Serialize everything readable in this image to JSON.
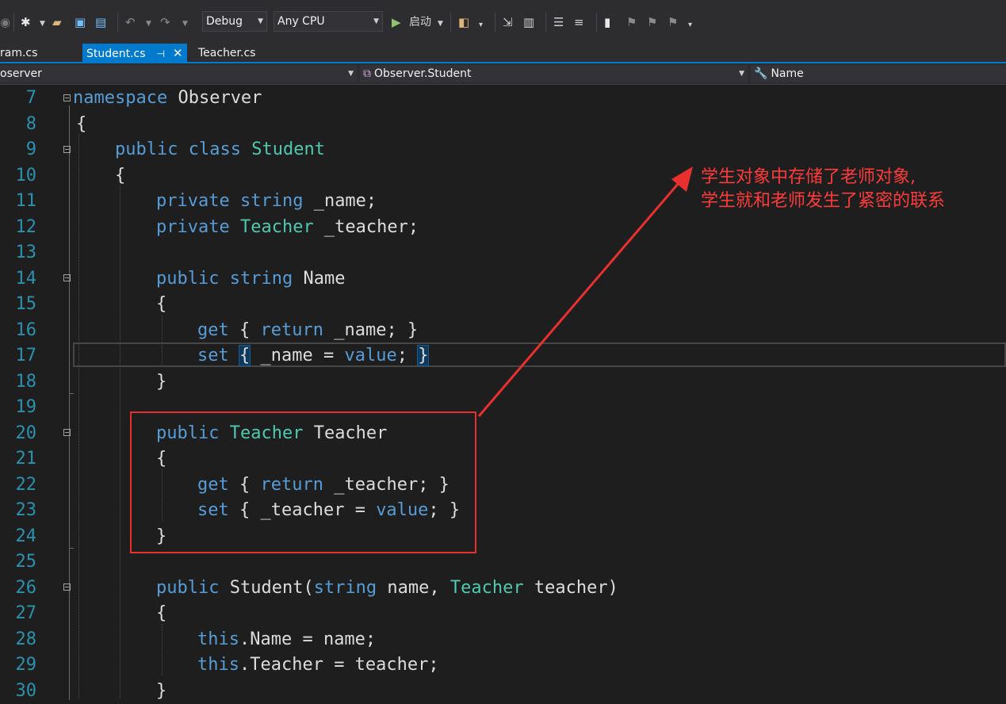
{
  "toolbar": {
    "config": "Debug",
    "platform": "Any CPU",
    "start_label": "启动"
  },
  "tabs": [
    {
      "label": "ram.cs"
    },
    {
      "label": "Student.cs"
    },
    {
      "label": "Teacher.cs"
    }
  ],
  "navbar": {
    "project": "oserver",
    "type": "Observer.Student",
    "member": "Name"
  },
  "lines": [
    {
      "n": "7"
    },
    {
      "n": "8"
    },
    {
      "n": "9"
    },
    {
      "n": "10"
    },
    {
      "n": "11"
    },
    {
      "n": "12"
    },
    {
      "n": "13"
    },
    {
      "n": "14"
    },
    {
      "n": "15"
    },
    {
      "n": "16"
    },
    {
      "n": "17"
    },
    {
      "n": "18"
    },
    {
      "n": "19"
    },
    {
      "n": "20"
    },
    {
      "n": "21"
    },
    {
      "n": "22"
    },
    {
      "n": "23"
    },
    {
      "n": "24"
    },
    {
      "n": "25"
    },
    {
      "n": "26"
    },
    {
      "n": "27"
    },
    {
      "n": "28"
    },
    {
      "n": "29"
    },
    {
      "n": "30"
    }
  ],
  "code": {
    "l7": [
      "namespace",
      " Observer"
    ],
    "l8": [
      "{"
    ],
    "l9": [
      "public",
      " ",
      "class",
      " ",
      "Student"
    ],
    "l10": [
      "{"
    ],
    "l11": [
      "private",
      " ",
      "string",
      " _name;"
    ],
    "l12": [
      "private",
      " ",
      "Teacher",
      " _teacher;"
    ],
    "l14": [
      "public",
      " ",
      "string",
      " Name"
    ],
    "l15": [
      "{"
    ],
    "l16": [
      "get",
      " { ",
      "return",
      " _name; }"
    ],
    "l17": [
      "set",
      " ",
      "{",
      " _name = ",
      "value",
      "; ",
      "}"
    ],
    "l18": [
      "}"
    ],
    "l20": [
      "public",
      " ",
      "Teacher",
      " Teacher"
    ],
    "l21": [
      "{"
    ],
    "l22": [
      "get",
      " { ",
      "return",
      " _teacher; }"
    ],
    "l23": [
      "set",
      " { _teacher = ",
      "value",
      "; }"
    ],
    "l24": [
      "}"
    ],
    "l26": [
      "public",
      " Student(",
      "string",
      " name, ",
      "Teacher",
      " teacher)"
    ],
    "l27": [
      "{"
    ],
    "l28": [
      "this",
      ".Name = name;"
    ],
    "l29": [
      "this",
      ".Teacher = teacher;"
    ],
    "l30": [
      "}"
    ]
  },
  "annotation": {
    "line1": "学生对象中存储了老师对象,",
    "line2": "学生就和老师发生了紧密的联系"
  },
  "colors": {
    "annotation": "#ff3b3b",
    "keyword": "#569cd6",
    "type": "#4ec9b0",
    "line_number": "#2b91af"
  }
}
